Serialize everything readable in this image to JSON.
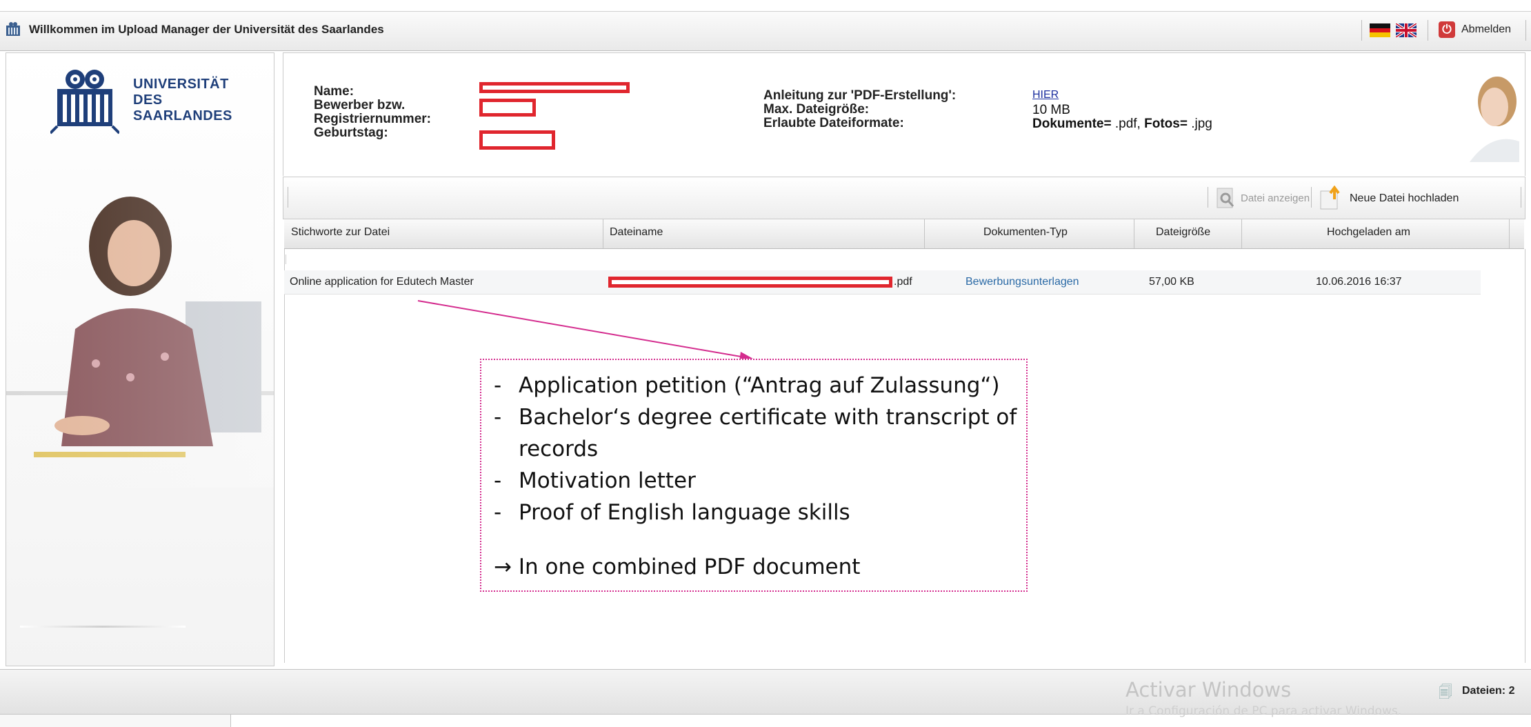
{
  "titlebar": {
    "title": "Willkommen im Upload Manager der Universität des Saarlandes",
    "logout_label": "Abmelden"
  },
  "university": {
    "name_line1": "UNIVERSITÄT",
    "name_line2": "DES",
    "name_line3": "SAARLANDES"
  },
  "info": {
    "name_label": "Name:",
    "applicant_label_1": "Bewerber bzw.",
    "applicant_label_2": "Registriernummer:",
    "birthday_label": "Geburtstag:",
    "pdf_guide_label": "Anleitung zur 'PDF-Erstellung':",
    "pdf_guide_link": "HIER",
    "max_size_label": "Max. Dateigröße:",
    "max_size_value": "10 MB",
    "formats_label": "Erlaubte Dateiformate:",
    "formats_docs_label": "Dokumente=",
    "formats_docs_value": ".pdf,",
    "formats_photos_label": "Fotos=",
    "formats_photos_value": ".jpg"
  },
  "toolbar": {
    "view_label": "Datei anzeigen",
    "upload_label": "Neue Datei hochladen"
  },
  "table": {
    "columns": [
      "Stichworte zur Datei",
      "Dateiname",
      "Dokumenten-Typ",
      "Dateigröße",
      "Hochgeladen am"
    ],
    "rows": [
      {
        "keywords": "Online application for Edutech Master",
        "filename_ext": ".pdf",
        "doc_type": "Bewerbungsunterlagen",
        "size": "57,00 KB",
        "uploaded": "10.06.2016 16:37"
      }
    ]
  },
  "note": {
    "items": [
      "Application petition (“Antrag auf Zulassung“)",
      "Bachelor‘s degree certificate with transcript of records",
      "Motivation letter",
      "Proof of English language skills"
    ],
    "summary": "→ In one combined PDF document"
  },
  "footer": {
    "files_count": "Dateien: 2",
    "watermark_title": "Activar Windows",
    "watermark_sub": "Ir a Configuración de PC para activar Windows."
  },
  "colors": {
    "redaction": "#e0262e",
    "annotation": "#d42c8e",
    "link": "#1a2d9e",
    "brand": "#1f3f7a"
  }
}
